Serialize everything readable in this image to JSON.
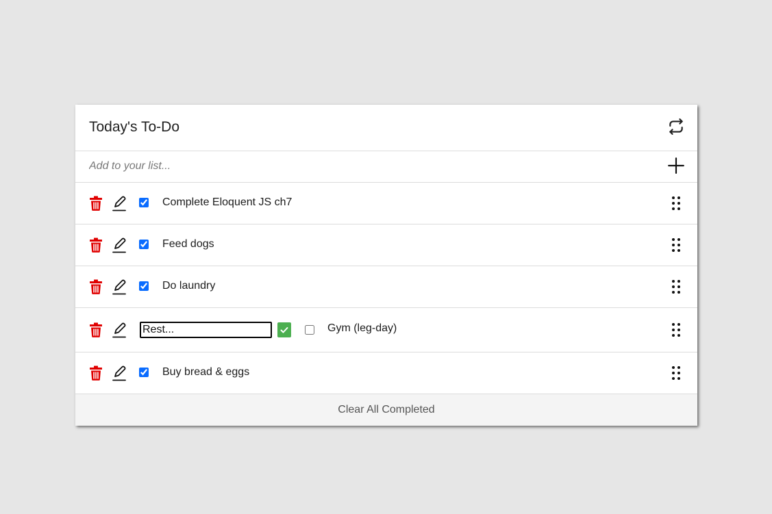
{
  "header": {
    "title": "Today's To-Do",
    "refresh_icon": "repeat-arrows-icon"
  },
  "add": {
    "placeholder": "Add to your list...",
    "value": "",
    "add_icon": "plus-icon"
  },
  "todos": [
    {
      "text": "Complete Eloquent JS ch7",
      "completed": true
    },
    {
      "text": "Feed dogs",
      "completed": true
    },
    {
      "text": "Do laundry",
      "completed": true
    },
    {
      "text": "Gym (leg-day)",
      "completed": false,
      "editing": true,
      "edit_value": "Rest..."
    },
    {
      "text": "Buy bread & eggs",
      "completed": true
    }
  ],
  "footer": {
    "clear_label": "Clear All Completed"
  },
  "colors": {
    "background": "#e6e6e6",
    "card": "#ffffff",
    "delete": "#e00000",
    "checkbox": "#0a6cff",
    "confirm": "#4caf50",
    "footer": "#f4f4f4"
  },
  "icons": {
    "delete": "trash-icon",
    "edit": "pencil-icon",
    "drag": "drag-handle-icon",
    "confirm": "checkmark-icon"
  }
}
